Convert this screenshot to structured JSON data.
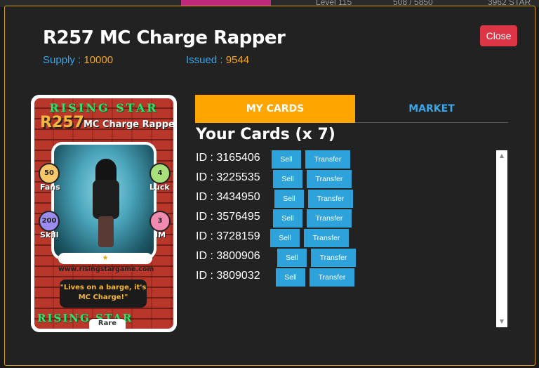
{
  "background": {
    "level_label": "Level 115",
    "progress_label": "508 / 5850",
    "stars_label": "3962 STAR"
  },
  "modal": {
    "title": "R257 MC Charge Rapper",
    "supply_label": "Supply :",
    "supply_value": "10000",
    "issued_label": "Issued :",
    "issued_value": "9544",
    "close_label": "Close"
  },
  "card": {
    "brand": "RISING STAR",
    "code": "R257",
    "name": "MC Charge Rapper",
    "stats": {
      "fans": {
        "value": "50",
        "label": "Fans"
      },
      "luck": {
        "value": "4",
        "label": "Luck"
      },
      "skill": {
        "value": "200",
        "label": "Skill"
      },
      "im": {
        "value": "3",
        "label": "IM"
      }
    },
    "url": "www.risingstargame.com",
    "quote": "\"Lives on a barge, it's MC Charge!\"",
    "rarity": "Rare"
  },
  "tabs": [
    {
      "label": "MY CARDS",
      "active": true
    },
    {
      "label": "MARKET",
      "active": false
    }
  ],
  "your_cards_title": "Your Cards (x 7)",
  "cards": [
    {
      "id": "ID : 3165406"
    },
    {
      "id": "ID : 3225535"
    },
    {
      "id": "ID : 3434950"
    },
    {
      "id": "ID : 3576495"
    },
    {
      "id": "ID : 3728159"
    },
    {
      "id": "ID : 3800906"
    },
    {
      "id": "ID : 3809032"
    }
  ],
  "buttons": {
    "sell": "Sell",
    "transfer": "Transfer"
  },
  "colors": {
    "accent_orange": "#ffa500",
    "accent_blue": "#2ea3db",
    "close_red": "#dc3545",
    "border_gold": "#d4a017"
  }
}
